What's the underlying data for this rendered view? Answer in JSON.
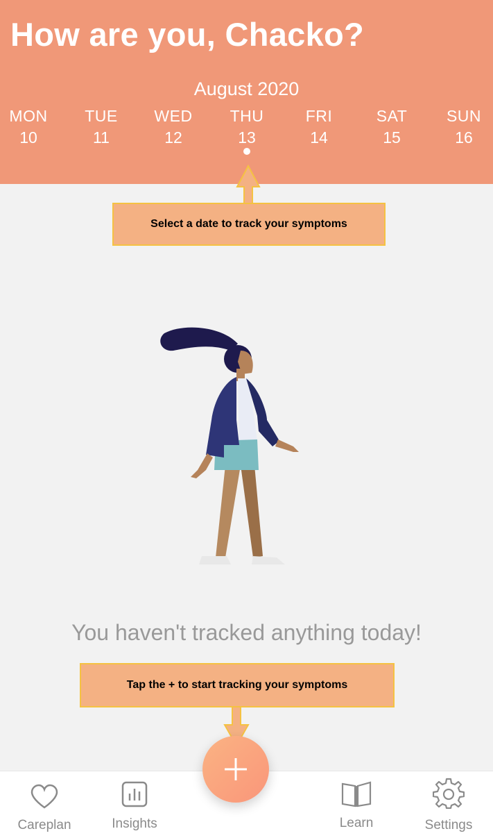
{
  "header": {
    "greeting": "How are you, Chacko?",
    "month": "August 2020",
    "days": [
      {
        "name": "MON",
        "num": "10"
      },
      {
        "name": "TUE",
        "num": "11"
      },
      {
        "name": "WED",
        "num": "12"
      },
      {
        "name": "THU",
        "num": "13"
      },
      {
        "name": "FRI",
        "num": "14"
      },
      {
        "name": "SAT",
        "num": "15"
      },
      {
        "name": "SUN",
        "num": "16"
      }
    ],
    "selected_day": "13"
  },
  "callouts": {
    "date_hint": "Select a date to track your symptoms",
    "plus_hint": "Tap the + to start tracking your symptoms"
  },
  "main": {
    "empty_message": "You haven't tracked anything today!"
  },
  "nav": {
    "careplan": "Careplan",
    "insights": "Insights",
    "learn": "Learn",
    "settings": "Settings"
  },
  "colors": {
    "header_bg": "#f09878",
    "callout_bg": "#f4b183",
    "callout_border": "#f5c242",
    "fab_start": "#fbb383",
    "fab_end": "#f9967a"
  },
  "icons": {
    "careplan": "heart-icon",
    "insights": "bar-chart-icon",
    "learn": "book-icon",
    "settings": "gear-icon",
    "fab": "plus-icon"
  }
}
